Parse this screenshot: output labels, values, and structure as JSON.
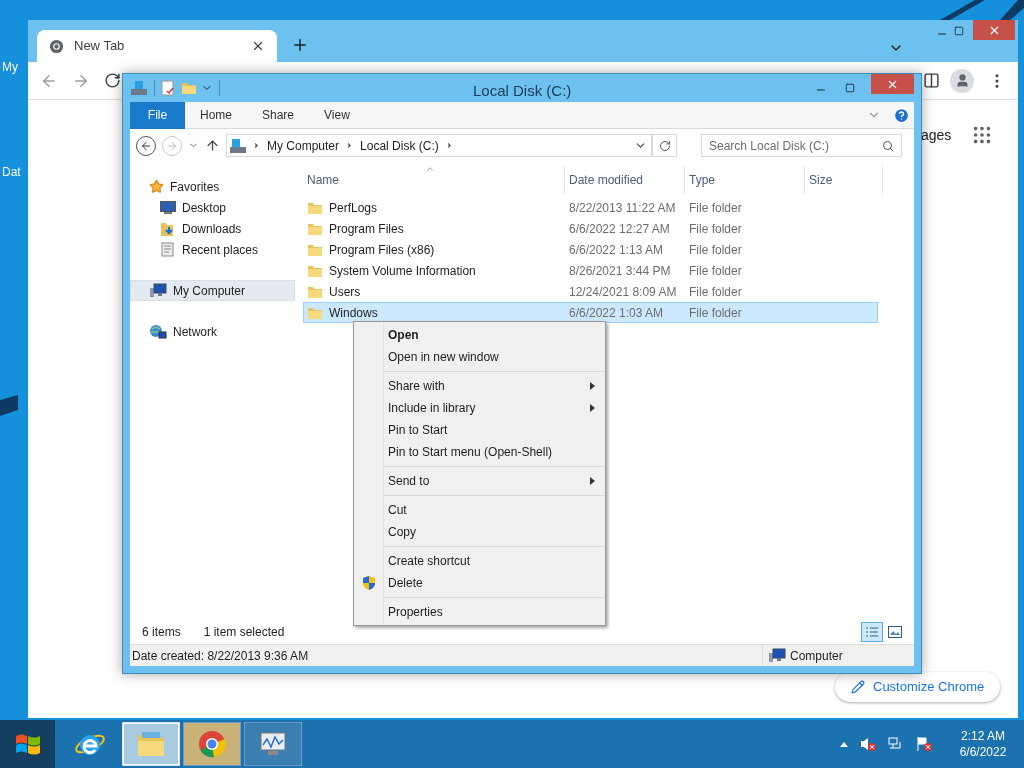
{
  "desktop": {
    "icons": [
      {
        "label": "My"
      },
      {
        "label": "Dat"
      }
    ]
  },
  "browser": {
    "tabs": [
      {
        "title": "New Tab",
        "selected": true
      }
    ],
    "page_link": "ages",
    "customize_button": "Customize Chrome"
  },
  "explorer": {
    "title": "Local Disk (C:)",
    "ribbon_tabs": [
      {
        "label": "File",
        "kind": "file"
      },
      {
        "label": "Home",
        "kind": "tab"
      },
      {
        "label": "Share",
        "kind": "tab"
      },
      {
        "label": "View",
        "kind": "tab"
      }
    ],
    "breadcrumb": [
      "My Computer",
      "Local Disk (C:)"
    ],
    "search": {
      "placeholder": "Search Local Disk (C:)"
    },
    "nav": [
      {
        "label": "Favorites",
        "kind": "star",
        "selected": false,
        "children": [
          {
            "label": "Desktop",
            "kind": "desktop",
            "selected": false
          },
          {
            "label": "Downloads",
            "kind": "downloads",
            "selected": false
          },
          {
            "label": "Recent places",
            "kind": "recent",
            "selected": false
          }
        ]
      },
      {
        "label": "My Computer",
        "kind": "computer",
        "selected": true
      },
      {
        "label": "Network",
        "kind": "network",
        "selected": false
      }
    ],
    "columns": [
      "Name",
      "Date modified",
      "Type",
      "Size"
    ],
    "rows": [
      {
        "name": "PerfLogs",
        "date": "8/22/2013 11:22 AM",
        "type": "File folder",
        "selected": false
      },
      {
        "name": "Program Files",
        "date": "6/6/2022 12:27 AM",
        "type": "File folder",
        "selected": false
      },
      {
        "name": "Program Files (x86)",
        "date": "6/6/2022 1:13 AM",
        "type": "File folder",
        "selected": false
      },
      {
        "name": "System Volume Information",
        "date": "8/26/2021 3:44 PM",
        "type": "File folder",
        "selected": false
      },
      {
        "name": "Users",
        "date": "12/24/2021 8:09 AM",
        "type": "File folder",
        "selected": false
      },
      {
        "name": "Windows",
        "date": "6/6/2022 1:03 AM",
        "type": "File folder",
        "selected": true
      }
    ],
    "status": {
      "count": "6 items",
      "selection": "1 item selected"
    },
    "details": {
      "text": "Date created: 8/22/2013 9:36 AM",
      "location": "Computer"
    }
  },
  "context_menu": [
    [
      {
        "label": "Open",
        "default": true,
        "submenu": false,
        "shield": false
      },
      {
        "label": "Open in new window",
        "default": false,
        "submenu": false,
        "shield": false
      }
    ],
    [
      {
        "label": "Share with",
        "default": false,
        "submenu": true,
        "shield": false
      },
      {
        "label": "Include in library",
        "default": false,
        "submenu": true,
        "shield": false
      },
      {
        "label": "Pin to Start",
        "default": false,
        "submenu": false,
        "shield": false
      },
      {
        "label": "Pin to Start menu (Open-Shell)",
        "default": false,
        "submenu": false,
        "shield": false
      }
    ],
    [
      {
        "label": "Send to",
        "default": false,
        "submenu": true,
        "shield": false
      }
    ],
    [
      {
        "label": "Cut",
        "default": false,
        "submenu": false,
        "shield": false
      },
      {
        "label": "Copy",
        "default": false,
        "submenu": false,
        "shield": false
      }
    ],
    [
      {
        "label": "Create shortcut",
        "default": false,
        "submenu": false,
        "shield": false
      },
      {
        "label": "Delete",
        "default": false,
        "submenu": false,
        "shield": true
      }
    ],
    [
      {
        "label": "Properties",
        "default": false,
        "submenu": false,
        "shield": false
      }
    ]
  ],
  "taskbar": {
    "apps": [
      {
        "kind": "ie",
        "running": false,
        "selected": false,
        "flashing": false
      },
      {
        "kind": "explorer",
        "running": true,
        "selected": true,
        "flashing": false
      },
      {
        "kind": "chrome",
        "running": true,
        "selected": false,
        "flashing": true
      },
      {
        "kind": "monitor",
        "running": true,
        "selected": false,
        "flashing": false
      }
    ],
    "clock": {
      "time": "2:12 AM",
      "date": "6/6/2022"
    }
  }
}
